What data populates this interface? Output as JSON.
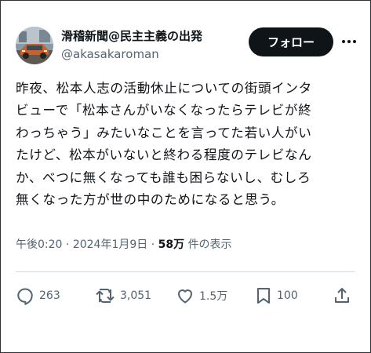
{
  "author": {
    "display_name": "滑稽新聞@民主主義の出発",
    "handle": "@akasakaroman"
  },
  "follow_label": "フォロー",
  "tweet": {
    "lines": [
      "昨夜、松本人志の活動休止についての街頭インタ",
      "ビューで「松本さんがいなくなったらテレビが終",
      "わっちゃう」みたいなことを言ってた若い人がい",
      "たけど、松本がいないと終わる程度のテレビなん",
      "か、べつに無くなっても誰も困らないし、むしろ",
      "無くなった方が世の中のためになると思う。"
    ]
  },
  "meta": {
    "time": "午後0:20",
    "separator": "·",
    "date": "2024年1月9日",
    "views_count": "58万",
    "views_label": "件の表示"
  },
  "actions": {
    "replies": "263",
    "reposts": "3,051",
    "likes": "1.5万",
    "bookmarks": "100"
  },
  "icons": {
    "reply": "reply-icon",
    "repost": "repost-icon",
    "like": "heart-icon",
    "bookmark": "bookmark-icon",
    "share": "share-icon",
    "more": "more-icon"
  },
  "colors": {
    "text": "#0f1419",
    "secondary": "#536471",
    "button_bg": "#0f1419",
    "button_text": "#ffffff",
    "divider": "#cfd9de"
  }
}
